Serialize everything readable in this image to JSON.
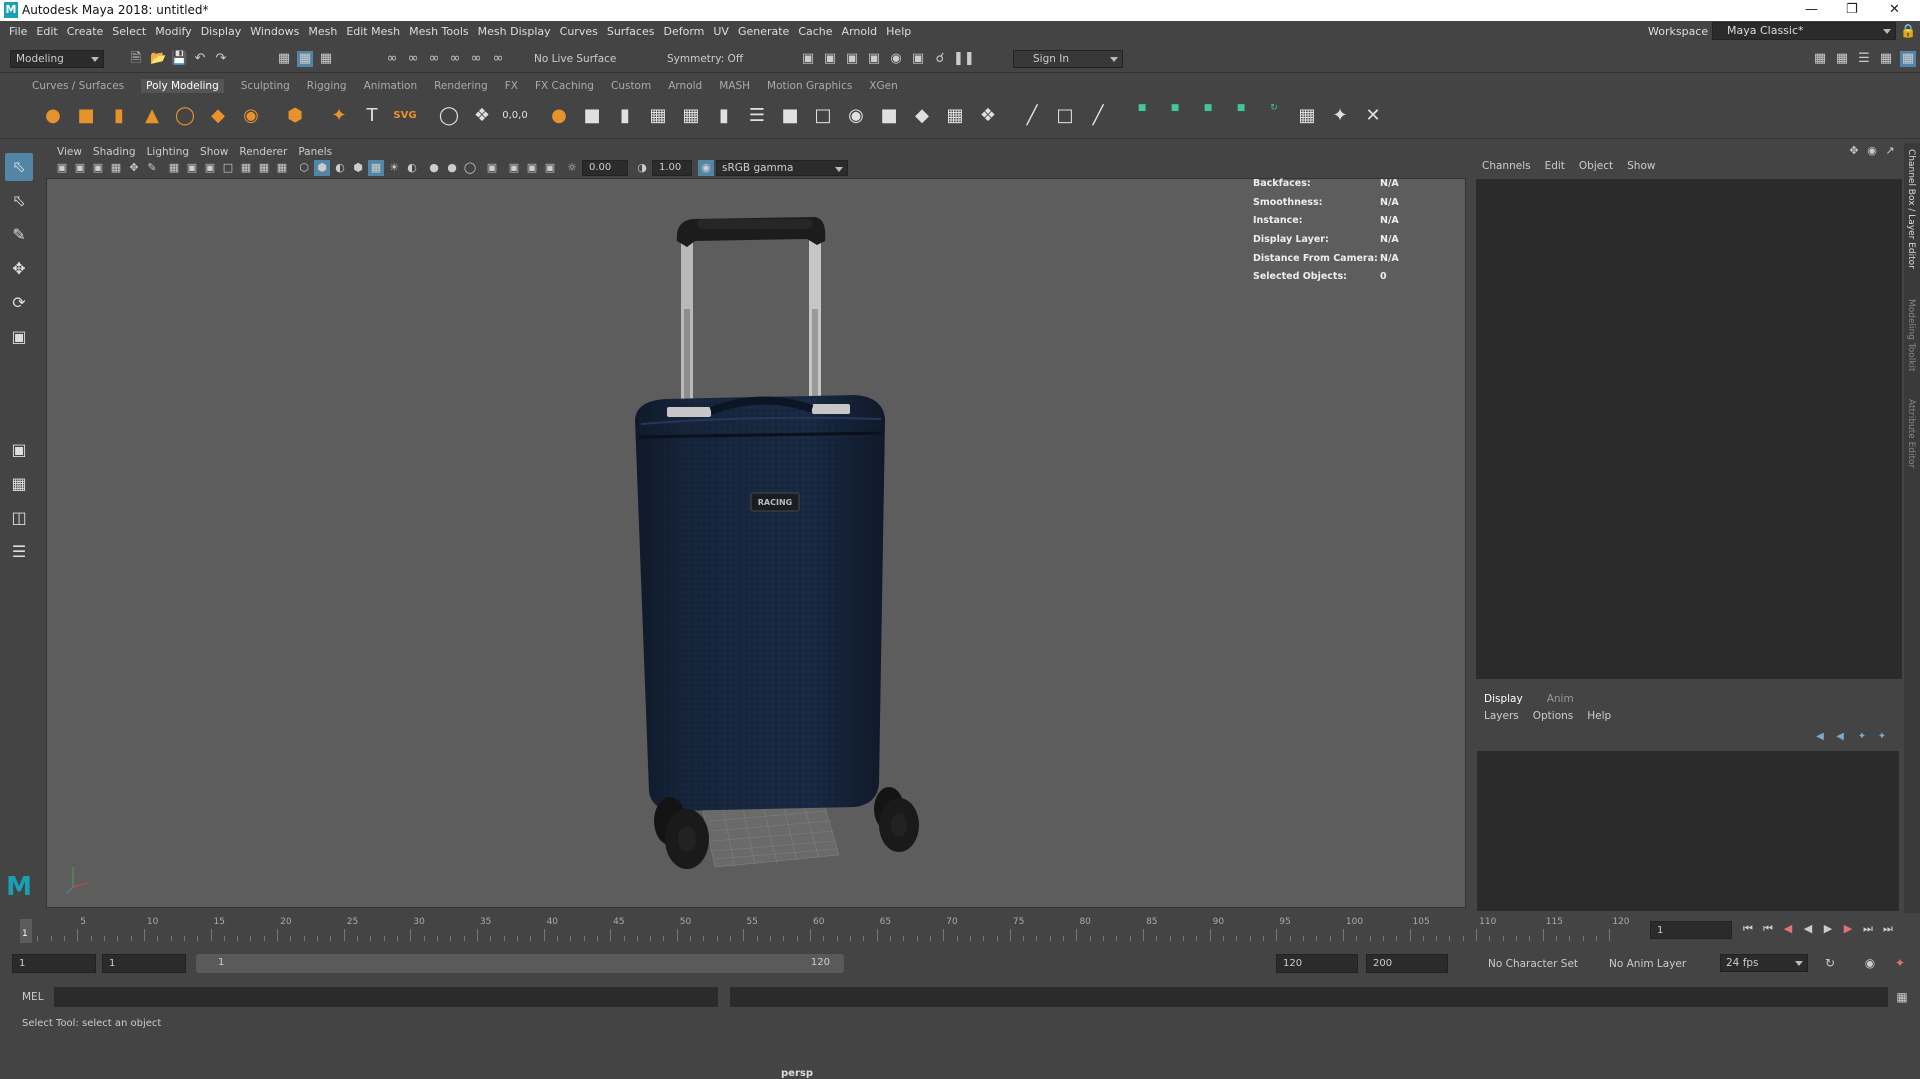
{
  "window": {
    "title": "Autodesk Maya 2018: untitled*"
  },
  "menubar": [
    "File",
    "Edit",
    "Create",
    "Select",
    "Modify",
    "Display",
    "Windows",
    "Mesh",
    "Edit Mesh",
    "Mesh Tools",
    "Mesh Display",
    "Curves",
    "Surfaces",
    "Deform",
    "UV",
    "Generate",
    "Cache",
    "Arnold",
    "Help"
  ],
  "workspace": {
    "label": "Workspace :",
    "value": "Maya Classic*"
  },
  "statusline": {
    "menuset": "Modeling",
    "live_surface": "No Live Surface",
    "symmetry": "Symmetry: Off",
    "sign_in": "Sign In"
  },
  "shelf_tabs": [
    "Curves / Surfaces",
    "Poly Modeling",
    "Sculpting",
    "Rigging",
    "Animation",
    "Rendering",
    "FX",
    "FX Caching",
    "Custom",
    "Arnold",
    "MASH",
    "Motion Graphics",
    "XGen"
  ],
  "shelf_active": "Poly Modeling",
  "viewport": {
    "menu": [
      "View",
      "Shading",
      "Lighting",
      "Show",
      "Renderer",
      "Panels"
    ],
    "exposure": "0.00",
    "gamma": "1.00",
    "color_space": "sRGB gamma",
    "camera": "persp",
    "badge_text": "RACING",
    "hud": [
      {
        "label": "Backfaces:",
        "value": "N/A"
      },
      {
        "label": "Smoothness:",
        "value": "N/A"
      },
      {
        "label": "Instance:",
        "value": "N/A"
      },
      {
        "label": "Display Layer:",
        "value": "N/A"
      },
      {
        "label": "Distance From Camera:",
        "value": "N/A"
      },
      {
        "label": "Selected Objects:",
        "value": "0"
      }
    ]
  },
  "channel_box": {
    "menu": [
      "Channels",
      "Edit",
      "Object",
      "Show"
    ],
    "layer_tabs": [
      "Display",
      "Anim"
    ],
    "layer_menu": [
      "Layers",
      "Options",
      "Help"
    ]
  },
  "side_tabs": [
    "Channel Box / Layer Editor",
    "Modeling Toolkit",
    "Attribute Editor"
  ],
  "timeslider": {
    "labels": [
      "5",
      "10",
      "15",
      "20",
      "25",
      "30",
      "35",
      "40",
      "45",
      "50",
      "55",
      "60",
      "65",
      "70",
      "75",
      "80",
      "85",
      "90",
      "95",
      "100",
      "105",
      "110",
      "115",
      "120"
    ],
    "current_frame": "1",
    "playhead": "1"
  },
  "range": {
    "start": "1",
    "inner_start": "1",
    "range_start": "1",
    "range_end": "120",
    "end": "120",
    "anim_end": "200"
  },
  "bottom": {
    "character_set": "No Character Set",
    "anim_layer": "No Anim Layer",
    "fps": "24 fps"
  },
  "cmdline": {
    "label": "MEL"
  },
  "helpline": {
    "text": "Select Tool: select an object"
  }
}
